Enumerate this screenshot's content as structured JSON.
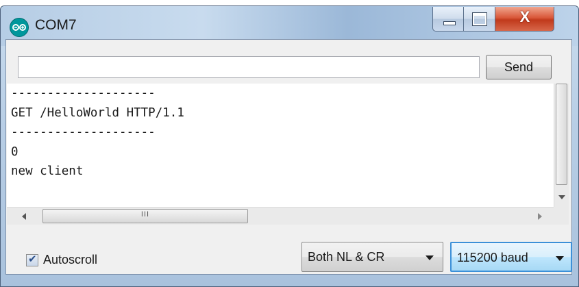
{
  "window": {
    "title": "COM7",
    "controls": {
      "minimize": "minimize",
      "maximize": "maximize",
      "close_label": "X"
    }
  },
  "send_bar": {
    "input_value": "",
    "send_label": "Send"
  },
  "output": {
    "lines": [
      "--------------------",
      "GET /HelloWorld HTTP/1.1",
      "--------------------",
      "0",
      "new client",
      ""
    ]
  },
  "scrollbars": {
    "hthumb_grip": "III"
  },
  "footer": {
    "autoscroll_label": "Autoscroll",
    "autoscroll_checked": true,
    "line_ending": "Both NL & CR",
    "baud_rate": "115200 baud"
  },
  "colors": {
    "arduino_teal": "#00979c",
    "close_red": "#c13a1c",
    "focus_blue": "#3c90d8"
  }
}
